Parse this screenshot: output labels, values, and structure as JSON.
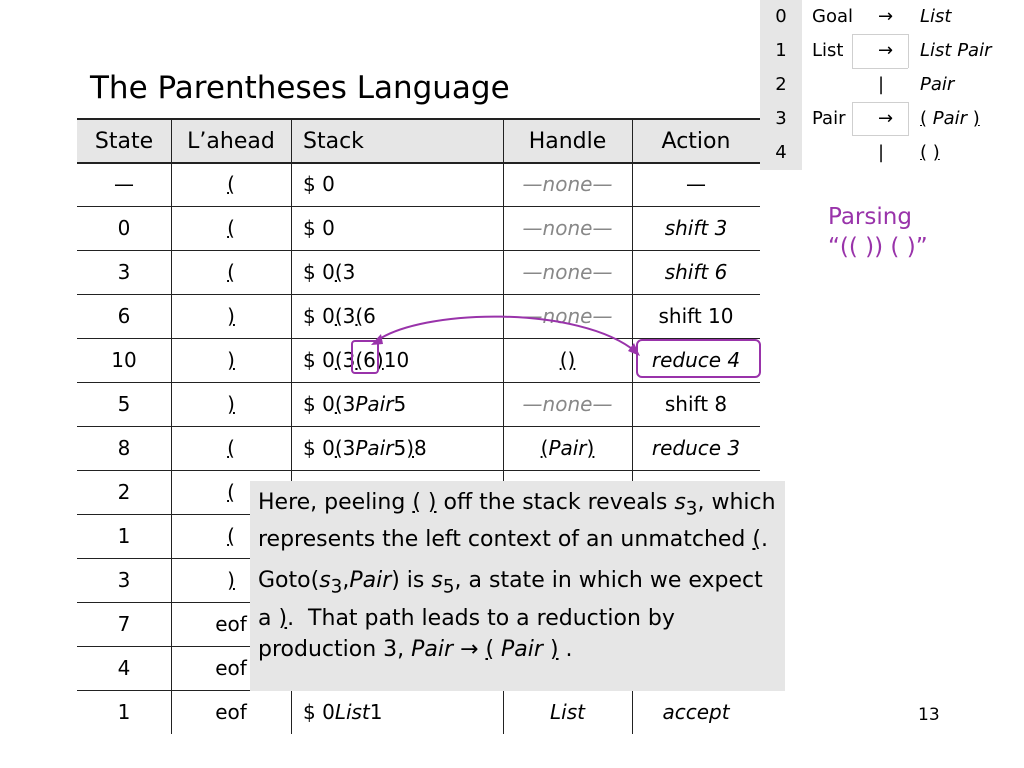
{
  "title": "The Parentheses Language",
  "grammar": [
    {
      "num": "0",
      "lhs": "Goal",
      "arrow": "→",
      "rhs": "List"
    },
    {
      "num": "1",
      "lhs": "List",
      "arrow": "→",
      "rhs": "List Pair"
    },
    {
      "num": "2",
      "lhs": "",
      "arrow": "|",
      "rhs": "Pair"
    },
    {
      "num": "3",
      "lhs": "Pair",
      "arrow": "→",
      "rhs": "( Pair )"
    },
    {
      "num": "4",
      "lhs": "",
      "arrow": "|",
      "rhs": "( )"
    }
  ],
  "table": {
    "headers": [
      "State",
      "L’ahead",
      "Stack",
      "Handle",
      "Action"
    ],
    "rows": [
      [
        "—",
        "(",
        "$ 0",
        "—none—",
        "—"
      ],
      [
        "0",
        "(",
        "$ 0",
        "—none—",
        "shift 3"
      ],
      [
        "3",
        "(",
        "$ 0 ( 3",
        "—none—",
        "shift 6"
      ],
      [
        "6",
        ")",
        "$ 0 ( 3 ( 6",
        "—none—",
        "shift 10"
      ],
      [
        "10",
        ")",
        "$ 0 ( 3 ( 6 ) 10",
        "( )",
        "reduce 4"
      ],
      [
        "5",
        ")",
        "$ 0 ( 3 Pair 5",
        "—none—",
        "shift 8"
      ],
      [
        "8",
        "(",
        "$ 0 ( 3 Pair 5 ) 8",
        "( Pair )",
        "reduce 3"
      ],
      [
        "2",
        "(",
        "",
        "",
        ""
      ],
      [
        "1",
        "(",
        "",
        "",
        ""
      ],
      [
        "3",
        ")",
        "",
        "",
        ""
      ],
      [
        "7",
        "eof",
        "",
        "",
        ""
      ],
      [
        "4",
        "eof",
        "",
        "",
        ""
      ],
      [
        "1",
        "eof",
        "$ 0 List 1",
        "List",
        "accept"
      ]
    ]
  },
  "parsing": {
    "line1": "Parsing",
    "line2": "“(( )) ( )”"
  },
  "callout": {
    "p1": "Here, peeling ( ) off the stack reveals s3, which represents the left context of an unmatched (.",
    "p2": "Goto(s3,Pair) is s5, a state in which we expect a ).  That path leads to a reduction by production 3, Pair → ( Pair ) ."
  },
  "page_number": "13",
  "colors": {
    "accent": "#9933aa",
    "header_bg": "#e6e6e6",
    "none_text": "#888888"
  }
}
